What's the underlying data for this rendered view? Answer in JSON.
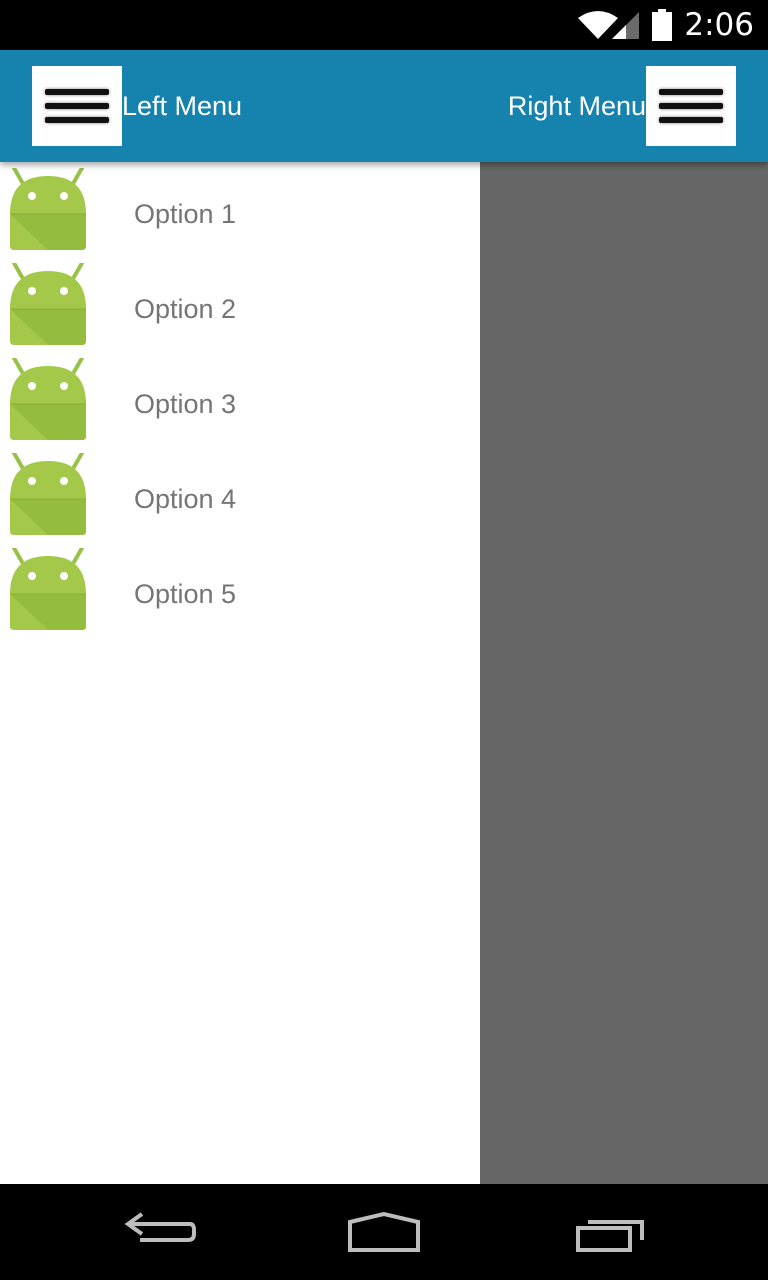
{
  "status_bar": {
    "time": "2:06",
    "icons": [
      "wifi-icon",
      "signal-icon",
      "battery-icon"
    ]
  },
  "app_bar": {
    "background_color": "#1682ae",
    "left_title": "Left Menu",
    "right_title": "Right Menu",
    "left_button_icon": "hamburger-icon",
    "right_button_icon": "hamburger-icon"
  },
  "drawer": {
    "items": [
      {
        "label": "Option 1",
        "icon": "android-robot-icon"
      },
      {
        "label": "Option 2",
        "icon": "android-robot-icon"
      },
      {
        "label": "Option 3",
        "icon": "android-robot-icon"
      },
      {
        "label": "Option 4",
        "icon": "android-robot-icon"
      },
      {
        "label": "Option 5",
        "icon": "android-robot-icon"
      }
    ]
  },
  "nav_bar": {
    "buttons": [
      "back-icon",
      "home-icon",
      "recents-icon"
    ]
  }
}
